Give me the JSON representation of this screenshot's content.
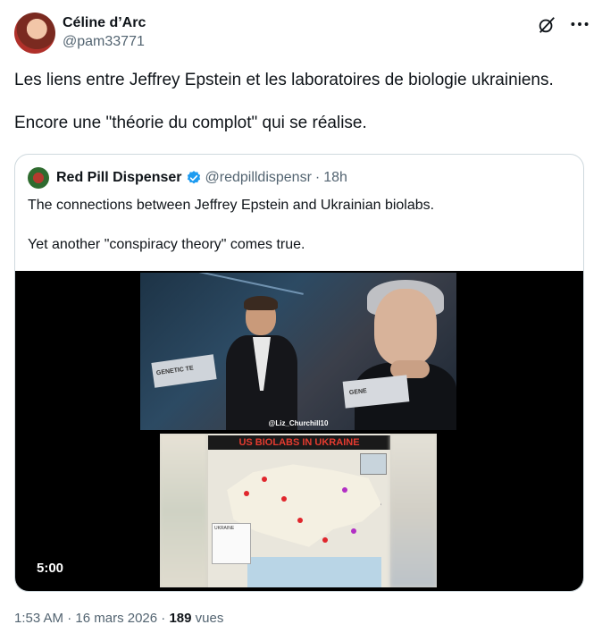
{
  "author": {
    "name": "Céline d’Arc",
    "handle": "@pam33771"
  },
  "tweet": {
    "line1": "Les liens entre Jeffrey Epstein et les laboratoires de biologie ukrainiens.",
    "line2": "Encore une \"théorie du complot\" qui se réalise."
  },
  "quote": {
    "name": "Red Pill Dispenser",
    "handle": "@redpilldispensr",
    "separator": "·",
    "time": "18h",
    "line1": "The connections between Jeffrey Epstein and Ukrainian biolabs.",
    "line2": "Yet another \"conspiracy theory\" comes true."
  },
  "video": {
    "duration": "5:00",
    "watermark": "@Liz_Churchill10",
    "card_text": "GENETIC TE",
    "card_text2": "GENE",
    "map_title": "US BIOLABS IN UKRAINE",
    "legend_title": "UKRAINE"
  },
  "footer": {
    "time": "1:53 AM",
    "sep1": "·",
    "date": "16 mars 2026",
    "sep2": "·",
    "views_count": "189",
    "views_label": "vues"
  },
  "colors": {
    "verified": "#1d9bf0",
    "secondary_text": "#536471",
    "biolab_dot": "#e0262c",
    "biolab_dot_alt": "#b22fc4"
  },
  "icons": {
    "grok": "grok-icon",
    "more": "more-icon",
    "verified": "verified-badge-icon"
  }
}
